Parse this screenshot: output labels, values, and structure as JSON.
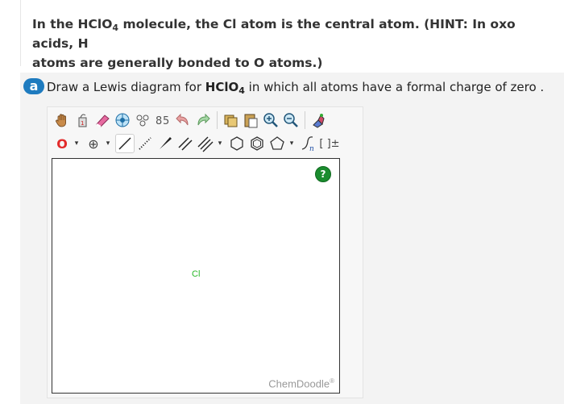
{
  "hint": {
    "line1_a": "In the HClO",
    "line1_sub": "4",
    "line1_b": " molecule, the Cl atom is the central atom. (HINT: In oxo acids, H",
    "line2": "atoms are generally bonded to O atoms.)"
  },
  "part": {
    "badge": "a",
    "prompt_a": "Draw a Lewis diagram for ",
    "formula": "HClO",
    "formula_sub": "4",
    "prompt_b": " in which all atoms have a formal charge of zero ."
  },
  "toolbar": {
    "atom_selector_value": "O",
    "charge_symbol": "⊕",
    "dropdown_arrow": "▾",
    "bracket_label": "[ ]±"
  },
  "canvas": {
    "atoms": [
      {
        "symbol": "Cl"
      }
    ],
    "help_label": "?",
    "brand": "ChemDoodle",
    "brand_mark": "®"
  },
  "colors": {
    "badge": "#1e7bbf",
    "atom_o": "#e22b2b",
    "atom_cl": "#28b828",
    "help": "#1a8c2e"
  }
}
